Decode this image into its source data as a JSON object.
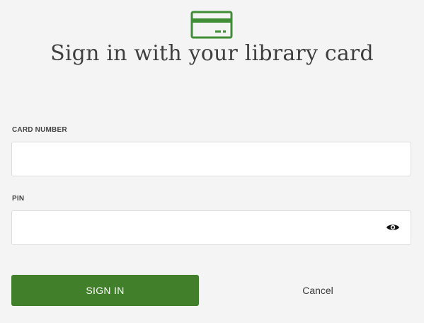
{
  "header": {
    "icon": "library-card-icon",
    "title": "Sign in with your library card"
  },
  "form": {
    "card_number_label": "CARD NUMBER",
    "card_number_value": "",
    "card_number_placeholder": "",
    "pin_label": "PIN",
    "pin_value": "",
    "pin_placeholder": "",
    "pin_toggle_icon": "eye-icon"
  },
  "actions": {
    "sign_in_label": "SIGN IN",
    "cancel_label": "Cancel"
  },
  "colors": {
    "primary": "#417f2a",
    "icon_green": "#3f8d35",
    "background": "#f4f4f4",
    "input_background": "#ffffff",
    "input_border": "#dcdcdc",
    "text": "#3f3f3f"
  }
}
